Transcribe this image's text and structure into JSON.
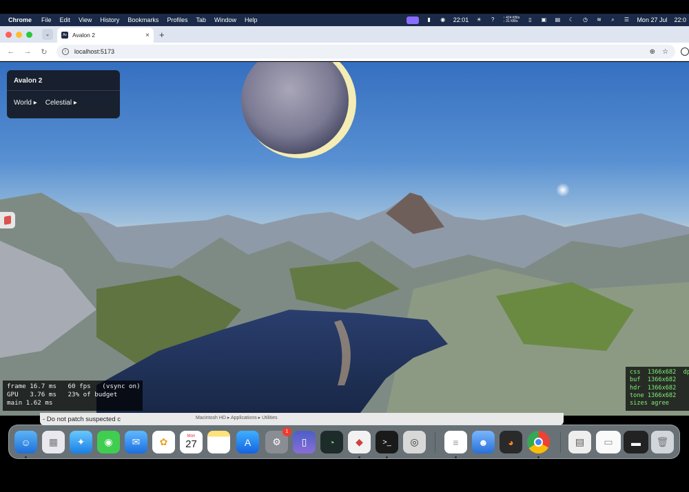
{
  "menubar": {
    "app": "Chrome",
    "items": [
      "File",
      "Edit",
      "View",
      "History",
      "Bookmarks",
      "Profiles",
      "Tab",
      "Window",
      "Help"
    ],
    "time": "22:01",
    "net_up": "424 KB/s",
    "net_down": "31 KB/s",
    "date": "Mon 27 Jul",
    "clock": "22:0"
  },
  "browser": {
    "tab_title": "Avalon 2",
    "favicon_text": "Av",
    "url": "localhost:5173"
  },
  "app_panel": {
    "title": "Avalon 2",
    "menus": [
      "World ▸",
      "Celestial ▸"
    ]
  },
  "stats": {
    "line1": "frame 16.7 ms   60 fps   (vsync on)",
    "line2": "GPU   3.76 ms   23% of budget",
    "line3": "main 1.62 ms"
  },
  "sizes": {
    "css": "css  1366x682  dp",
    "buf": "buf  1366x682",
    "hdr": "hdr  1366x682",
    "tone": "tone 1366x682",
    "agree": "sizes agree"
  },
  "background_window": {
    "text": "- Do not patch suspected c",
    "breadcrumb": "Macintosh HD ▸ Applications ▸ Utilities"
  },
  "dock": {
    "calendar_month": "Mon",
    "calendar_day": "27",
    "settings_badge": "1"
  },
  "colors": {
    "menubar": "#1a2a48",
    "panel": "#161a24",
    "sizes_text": "#7ff07a"
  }
}
